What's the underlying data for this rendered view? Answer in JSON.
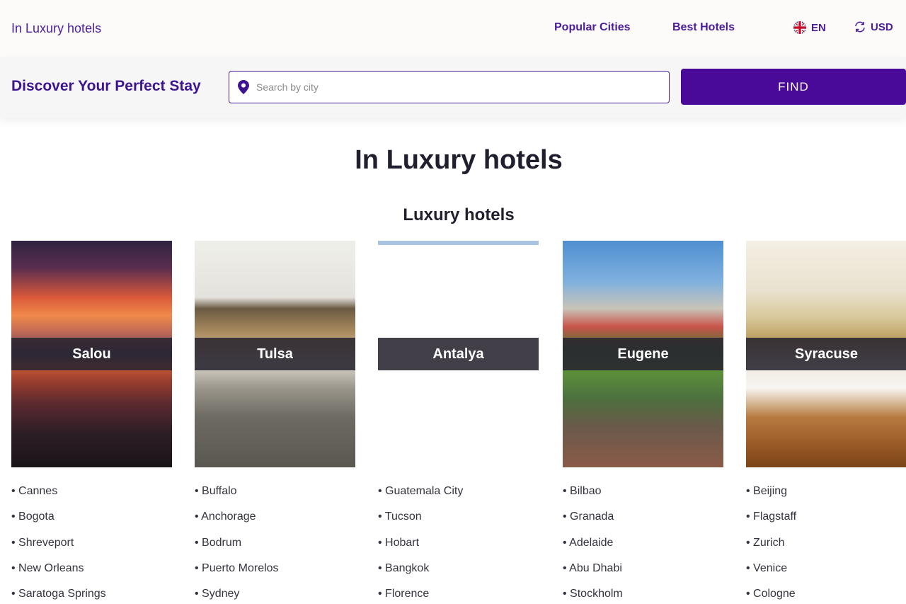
{
  "header": {
    "brand": "In Luxury hotels",
    "nav": {
      "popular_cities": "Popular Cities",
      "best_hotels": "Best Hotels"
    },
    "language": {
      "label": "EN",
      "icon": "uk-flag-icon"
    },
    "currency": {
      "label": "USD",
      "icon": "refresh-icon"
    }
  },
  "search": {
    "heading": "Discover Your Perfect Stay",
    "placeholder": "Search by city",
    "value": "",
    "button_label": "FIND",
    "icon": "location-pin-icon"
  },
  "main": {
    "title": "In Luxury hotels",
    "section_title": "Luxury hotels",
    "cards": [
      {
        "label": "Salou"
      },
      {
        "label": "Tulsa"
      },
      {
        "label": "Antalya"
      },
      {
        "label": "Eugene"
      },
      {
        "label": "Syracuse"
      }
    ],
    "city_columns": [
      [
        "Cannes",
        "Bogota",
        "Shreveport",
        "New Orleans",
        "Saratoga Springs"
      ],
      [
        "Buffalo",
        "Anchorage",
        "Bodrum",
        "Puerto Morelos",
        "Sydney"
      ],
      [
        "Guatemala City",
        "Tucson",
        "Hobart",
        "Bangkok",
        "Florence"
      ],
      [
        "Bilbao",
        "Granada",
        "Adelaide",
        "Abu Dhabi",
        "Stockholm"
      ],
      [
        "Beijing",
        "Flagstaff",
        "Zurich",
        "Venice",
        "Cologne"
      ]
    ]
  },
  "colors": {
    "brand_purple": "#4b1c9c",
    "button_purple": "#4a0a99",
    "label_overlay": "#282430"
  }
}
